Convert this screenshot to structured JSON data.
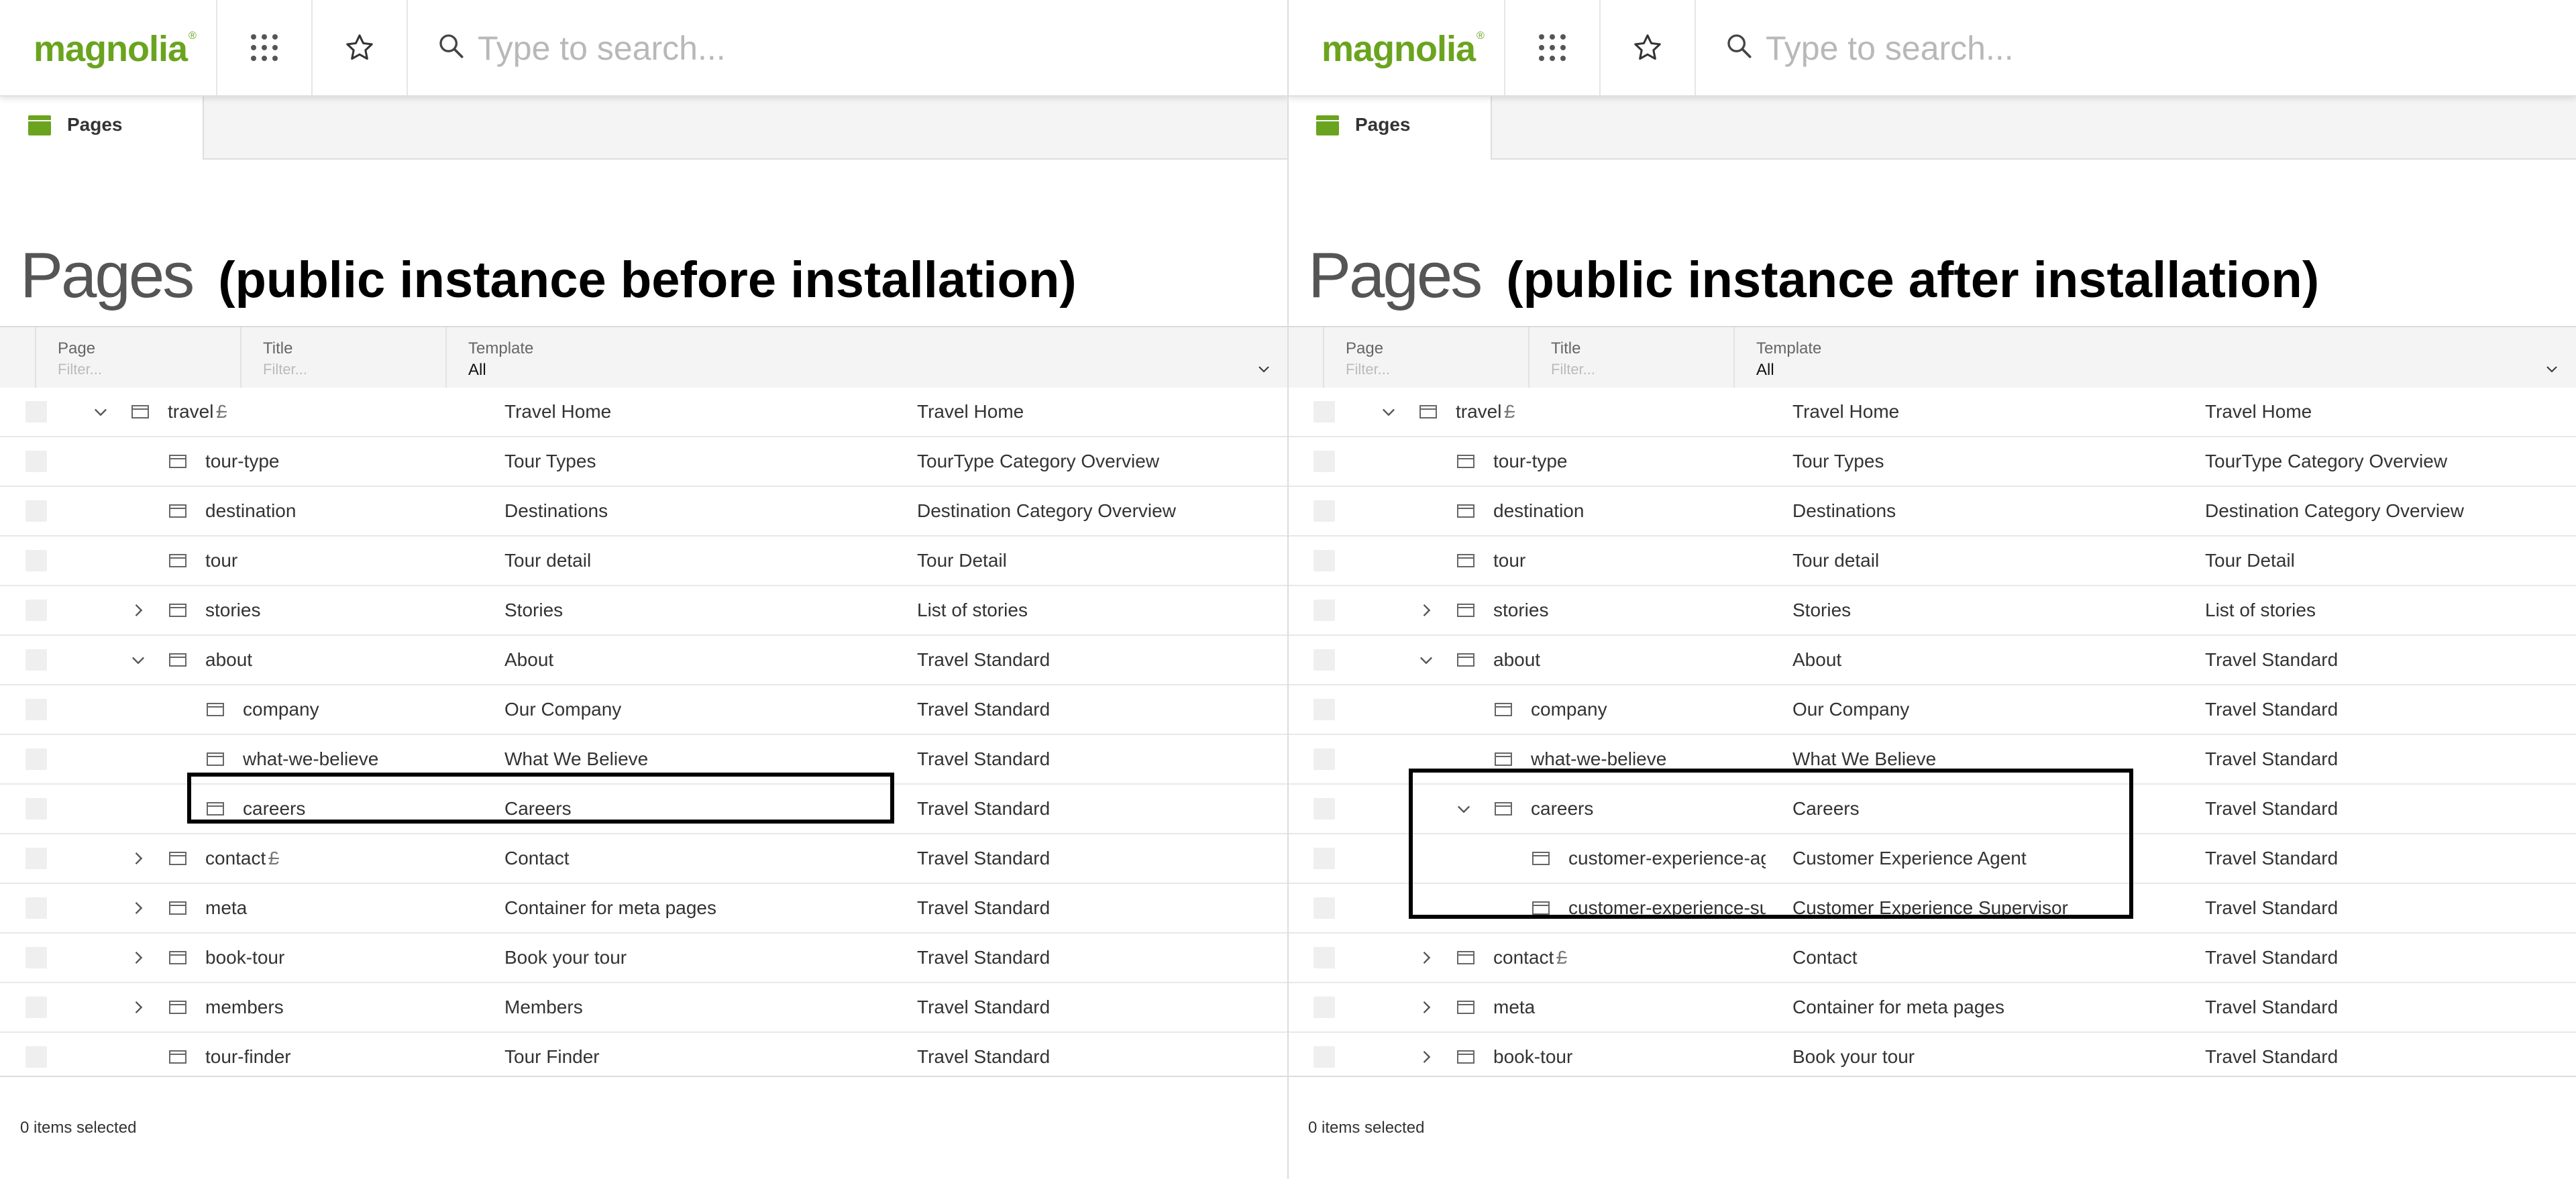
{
  "left": {
    "logo": "magnolia",
    "logo_mark": "®",
    "search_placeholder": "Type to search...",
    "tab_label": "Pages",
    "heading_title": "Pages",
    "heading_annotation": "(public instance before installation)",
    "columns": {
      "page": "Page",
      "page_filter": "Filter...",
      "title": "Title",
      "title_filter": "Filter...",
      "template": "Template",
      "template_value": "All"
    },
    "rows": [
      {
        "depth": 0,
        "expander": "expanded",
        "name": "travel",
        "locked": true,
        "title": "Travel Home",
        "template": "Travel Home"
      },
      {
        "depth": 1,
        "expander": "none",
        "name": "tour-type",
        "locked": false,
        "title": "Tour Types",
        "template": "TourType Category Overview"
      },
      {
        "depth": 1,
        "expander": "none",
        "name": "destination",
        "locked": false,
        "title": "Destinations",
        "template": "Destination Category Overview"
      },
      {
        "depth": 1,
        "expander": "none",
        "name": "tour",
        "locked": false,
        "title": "Tour detail",
        "template": "Tour Detail"
      },
      {
        "depth": 1,
        "expander": "collapsed",
        "name": "stories",
        "locked": false,
        "title": "Stories",
        "template": "List of stories"
      },
      {
        "depth": 1,
        "expander": "expanded",
        "name": "about",
        "locked": false,
        "title": "About",
        "template": "Travel Standard"
      },
      {
        "depth": 2,
        "expander": "none",
        "name": "company",
        "locked": false,
        "title": "Our Company",
        "template": "Travel Standard"
      },
      {
        "depth": 2,
        "expander": "none",
        "name": "what-we-believe",
        "locked": false,
        "title": "What We Believe",
        "template": "Travel Standard"
      },
      {
        "depth": 2,
        "expander": "none",
        "name": "careers",
        "locked": false,
        "title": "Careers",
        "template": "Travel Standard"
      },
      {
        "depth": 1,
        "expander": "collapsed",
        "name": "contact",
        "locked": true,
        "title": "Contact",
        "template": "Travel Standard"
      },
      {
        "depth": 1,
        "expander": "collapsed",
        "name": "meta",
        "locked": false,
        "title": "Container for meta pages",
        "template": "Travel Standard"
      },
      {
        "depth": 1,
        "expander": "collapsed",
        "name": "book-tour",
        "locked": false,
        "title": "Book your tour",
        "template": "Travel Standard"
      },
      {
        "depth": 1,
        "expander": "collapsed",
        "name": "members",
        "locked": false,
        "title": "Members",
        "template": "Travel Standard"
      },
      {
        "depth": 1,
        "expander": "none",
        "name": "tour-finder",
        "locked": false,
        "title": "Tour Finder",
        "template": "Travel Standard"
      }
    ],
    "status": "0 items selected"
  },
  "right": {
    "logo": "magnolia",
    "logo_mark": "®",
    "search_placeholder": "Type to search...",
    "tab_label": "Pages",
    "heading_title": "Pages",
    "heading_annotation": "(public instance after installation)",
    "columns": {
      "page": "Page",
      "page_filter": "Filter...",
      "title": "Title",
      "title_filter": "Filter...",
      "template": "Template",
      "template_value": "All"
    },
    "rows": [
      {
        "depth": 0,
        "expander": "expanded",
        "name": "travel",
        "locked": true,
        "title": "Travel Home",
        "template": "Travel Home"
      },
      {
        "depth": 1,
        "expander": "none",
        "name": "tour-type",
        "locked": false,
        "title": "Tour Types",
        "template": "TourType Category Overview"
      },
      {
        "depth": 1,
        "expander": "none",
        "name": "destination",
        "locked": false,
        "title": "Destinations",
        "template": "Destination Category Overview"
      },
      {
        "depth": 1,
        "expander": "none",
        "name": "tour",
        "locked": false,
        "title": "Tour detail",
        "template": "Tour Detail"
      },
      {
        "depth": 1,
        "expander": "collapsed",
        "name": "stories",
        "locked": false,
        "title": "Stories",
        "template": "List of stories"
      },
      {
        "depth": 1,
        "expander": "expanded",
        "name": "about",
        "locked": false,
        "title": "About",
        "template": "Travel Standard"
      },
      {
        "depth": 2,
        "expander": "none",
        "name": "company",
        "locked": false,
        "title": "Our Company",
        "template": "Travel Standard"
      },
      {
        "depth": 2,
        "expander": "none",
        "name": "what-we-believe",
        "locked": false,
        "title": "What We Believe",
        "template": "Travel Standard"
      },
      {
        "depth": 2,
        "expander": "expanded",
        "name": "careers",
        "locked": false,
        "title": "Careers",
        "template": "Travel Standard"
      },
      {
        "depth": 3,
        "expander": "none",
        "name": "customer-experience-age",
        "locked": false,
        "title": "Customer Experience Agent",
        "template": "Travel Standard"
      },
      {
        "depth": 3,
        "expander": "none",
        "name": "customer-experience-sup",
        "locked": false,
        "title": "Customer Experience Supervisor",
        "template": "Travel Standard"
      },
      {
        "depth": 1,
        "expander": "collapsed",
        "name": "contact",
        "locked": true,
        "title": "Contact",
        "template": "Travel Standard"
      },
      {
        "depth": 1,
        "expander": "collapsed",
        "name": "meta",
        "locked": false,
        "title": "Container for meta pages",
        "template": "Travel Standard"
      },
      {
        "depth": 1,
        "expander": "collapsed",
        "name": "book-tour",
        "locked": false,
        "title": "Book your tour",
        "template": "Travel Standard"
      }
    ],
    "status": "0 items selected"
  },
  "icons": {
    "lock_glyph": "£",
    "menu": "app-launcher-icon",
    "favorite": "star-icon",
    "search": "search-icon",
    "tab": "pages-app-icon",
    "row": "page-icon"
  },
  "colors": {
    "brand_green": "#6aa41f",
    "highlight_border": "#000000"
  }
}
